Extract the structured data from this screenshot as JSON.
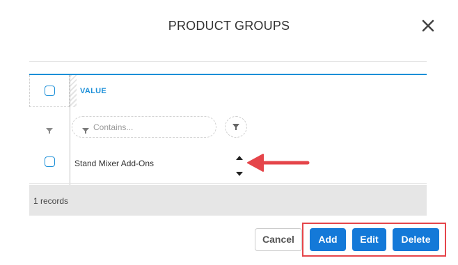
{
  "dialog": {
    "title": "PRODUCT GROUPS",
    "close_icon": "close-icon"
  },
  "grid": {
    "columns": [
      {
        "label": "VALUE"
      }
    ],
    "filter": {
      "placeholder": "Contains..."
    },
    "rows": [
      {
        "value": "Stand Mixer Add-Ons",
        "checked": false
      }
    ],
    "record_count_text": "1 records"
  },
  "actions": {
    "cancel_label": "Cancel",
    "add_label": "Add",
    "edit_label": "Edit",
    "delete_label": "Delete"
  },
  "colors": {
    "accent": "#1b8fd8",
    "primary_button": "#1479d8",
    "annotation_red": "#e5454a"
  }
}
